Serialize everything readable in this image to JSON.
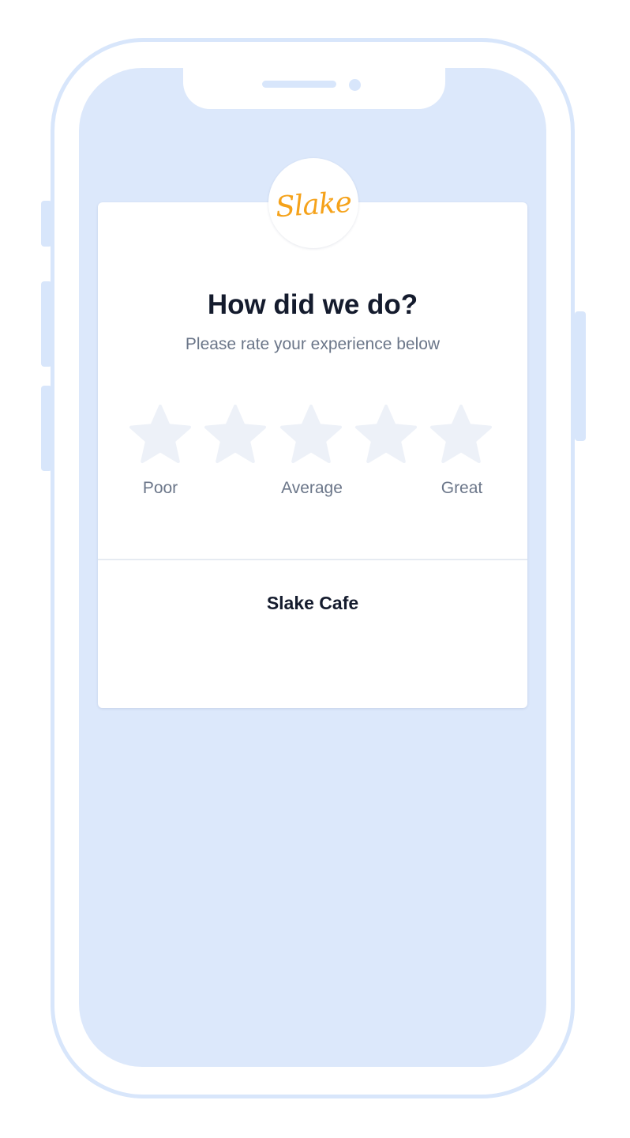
{
  "brand": {
    "logo_text": "Slake",
    "accent_color": "#f5a21a"
  },
  "survey": {
    "title": "How did we do?",
    "subtitle": "Please rate your experience below",
    "rating": {
      "max_stars": 5,
      "selected": 0,
      "labels": {
        "low": "Poor",
        "mid": "Average",
        "high": "Great"
      }
    }
  },
  "business": {
    "name": "Slake Cafe"
  },
  "icons": {
    "star": "star-icon"
  },
  "colors": {
    "screen_background": "#dce8fb",
    "phone_frame": "#d8e6fb",
    "star_empty": "#edf1f8",
    "title_text": "#141b2d",
    "muted_text": "#6b7689"
  }
}
